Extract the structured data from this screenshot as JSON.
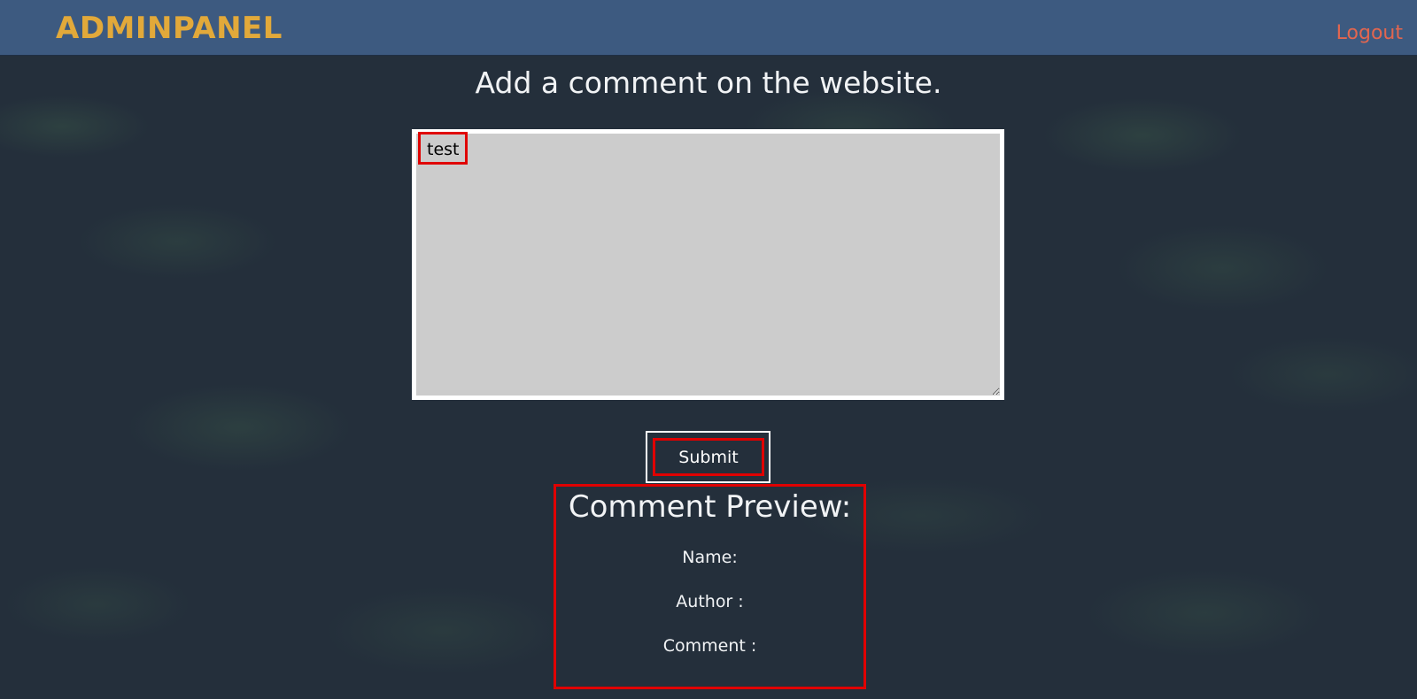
{
  "navbar": {
    "brand": "ADMINPANEL",
    "logout_label": "Logout"
  },
  "main": {
    "heading": "Add a comment on the website.",
    "comment_value": "test",
    "submit_label": "Submit"
  },
  "preview": {
    "title": "Comment Preview:",
    "name_label": "Name:",
    "author_label": "Author :",
    "comment_label": "Comment :"
  },
  "colors": {
    "navbar_bg": "#3d5a80",
    "brand": "#e2a93a",
    "logout": "#e2664f",
    "annotation": "#e00000",
    "textarea_bg": "#cccccc"
  }
}
